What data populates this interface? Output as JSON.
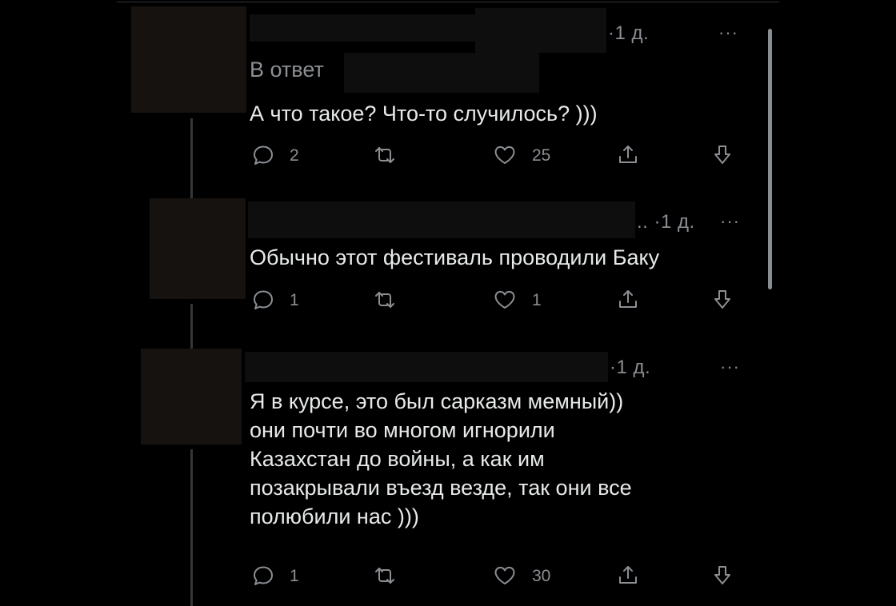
{
  "tweets": [
    {
      "time": "·1 д.",
      "more": "···",
      "reply_prefix": "В ответ",
      "text_lines": [
        "А что такое? Что-то случилось? )))"
      ],
      "counts": {
        "replies": "2",
        "retweets": "",
        "likes": "25"
      }
    },
    {
      "time": ".. ·1 д.",
      "more": "···",
      "text_lines": [
        "Обычно этот фестиваль проводили Баку"
      ],
      "counts": {
        "replies": "1",
        "retweets": "",
        "likes": "1"
      }
    },
    {
      "time": "·1 д.",
      "more": "···",
      "text_lines": [
        "Я в курсе, это был сарказм мемный))",
        "они почти во многом игнорили",
        "Казахстан до войны, а как им",
        "позакрывали въезд везде, так они все",
        "полюбили нас )))"
      ],
      "counts": {
        "replies": "1",
        "retweets": "",
        "likes": "30"
      }
    }
  ],
  "icons": [
    "reply-icon",
    "retweet-icon",
    "like-icon",
    "share-icon",
    "download-icon"
  ],
  "colors": {
    "background": "#000000",
    "text": "#e7e9ea",
    "muted": "#8b8f93"
  }
}
